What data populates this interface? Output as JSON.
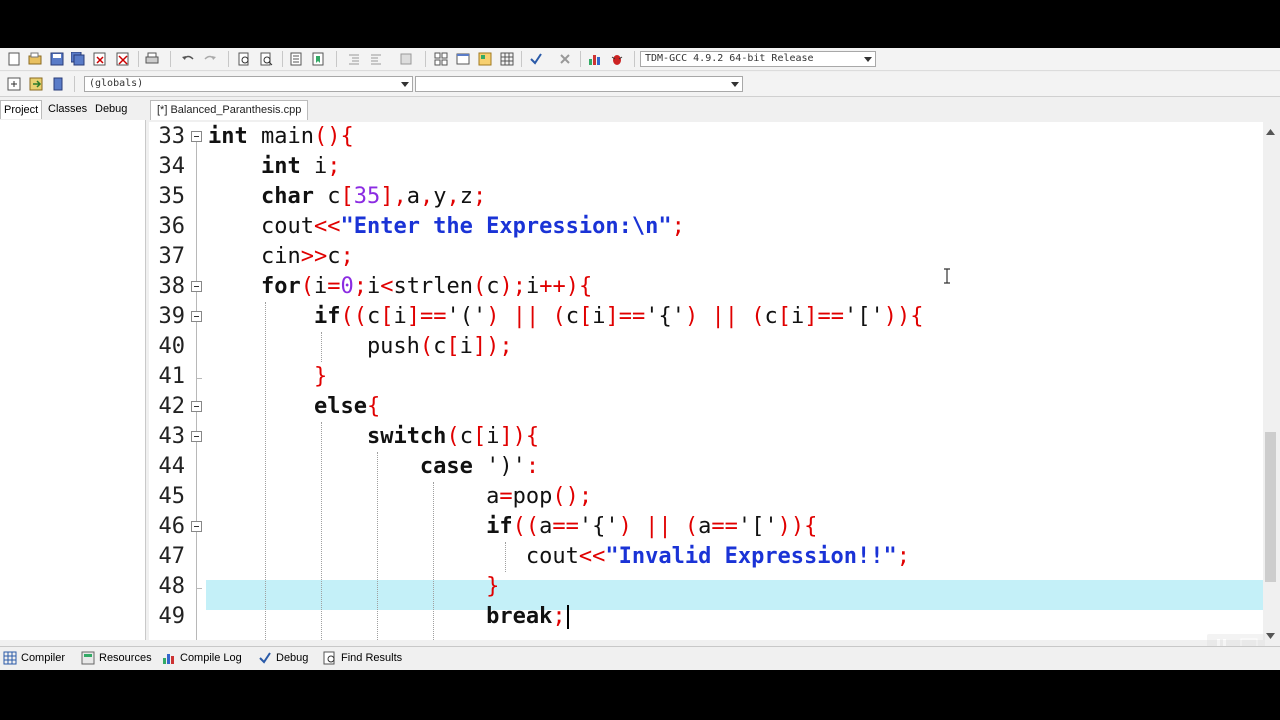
{
  "toolbar": {
    "compiler_select": "TDM-GCC 4.9.2 64-bit Release",
    "scope_select": "(globals)",
    "member_select": ""
  },
  "left_panel": {
    "tabs": [
      "Project",
      "Classes",
      "Debug"
    ]
  },
  "editor": {
    "tab_label": "[*] Balanced_Paranthesis.cpp",
    "line_numbers": [
      "33",
      "34",
      "35",
      "36",
      "37",
      "38",
      "39",
      "40",
      "41",
      "42",
      "43",
      "44",
      "45",
      "46",
      "47",
      "48",
      "49"
    ],
    "current_line": "49"
  },
  "bottom_tabs": [
    "Compiler",
    "Resources",
    "Compile Log",
    "Debug",
    "Find Results"
  ],
  "colors": {
    "operator": "#e00000",
    "string": "#1a33d6",
    "number": "#8b2be2",
    "current_line_bg": "#c4f0f8"
  }
}
